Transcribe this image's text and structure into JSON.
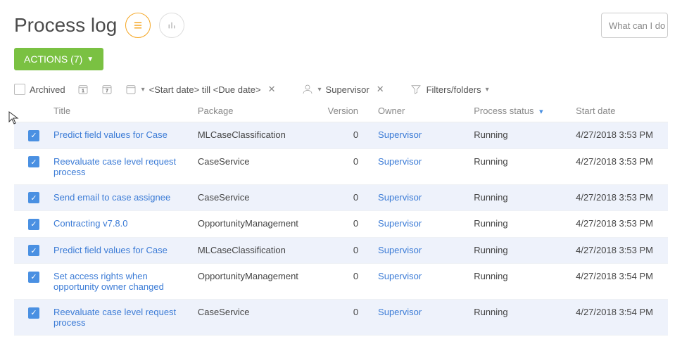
{
  "header": {
    "title": "Process log",
    "search_placeholder": "What can I do fo"
  },
  "actions": {
    "label": "ACTIONS (7)"
  },
  "filters": {
    "archived_label": "Archived",
    "date_range": "<Start date> till <Due date>",
    "owner": "Supervisor",
    "filters_label": "Filters/folders"
  },
  "columns": {
    "title": "Title",
    "package": "Package",
    "version": "Version",
    "owner": "Owner",
    "status": "Process status",
    "start": "Start date"
  },
  "rows": [
    {
      "checked": true,
      "title": "Predict field values for Case",
      "package": "MLCaseClassification",
      "version": "0",
      "owner": "Supervisor",
      "status": "Running",
      "start": "4/27/2018 3:53 PM"
    },
    {
      "checked": true,
      "title": "Reevaluate case level request process",
      "package": "CaseService",
      "version": "0",
      "owner": "Supervisor",
      "status": "Running",
      "start": "4/27/2018 3:53 PM"
    },
    {
      "checked": true,
      "title": "Send email to case assignee",
      "package": "CaseService",
      "version": "0",
      "owner": "Supervisor",
      "status": "Running",
      "start": "4/27/2018 3:53 PM"
    },
    {
      "checked": true,
      "title": "Contracting v7.8.0",
      "package": "OpportunityManagement",
      "version": "0",
      "owner": "Supervisor",
      "status": "Running",
      "start": "4/27/2018 3:53 PM"
    },
    {
      "checked": true,
      "title": "Predict field values for Case",
      "package": "MLCaseClassification",
      "version": "0",
      "owner": "Supervisor",
      "status": "Running",
      "start": "4/27/2018 3:53 PM"
    },
    {
      "checked": true,
      "title": "Set access rights when opportunity owner changed",
      "package": "OpportunityManagement",
      "version": "0",
      "owner": "Supervisor",
      "status": "Running",
      "start": "4/27/2018 3:54 PM"
    },
    {
      "checked": true,
      "title": "Reevaluate case level request process",
      "package": "CaseService",
      "version": "0",
      "owner": "Supervisor",
      "status": "Running",
      "start": "4/27/2018 3:54 PM"
    }
  ]
}
